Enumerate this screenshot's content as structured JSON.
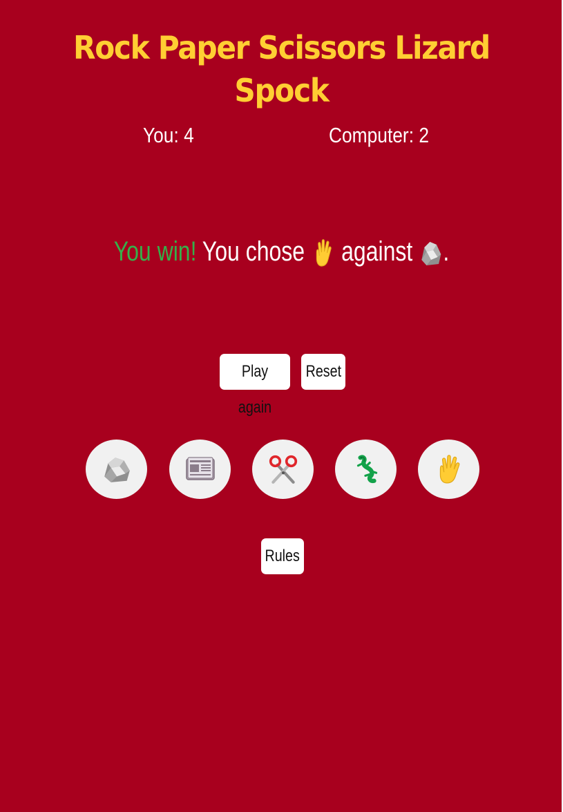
{
  "header": {
    "title": "Rock Paper Scissors Lizard Spock"
  },
  "score": {
    "you": "You: 4",
    "computer": "Computer: 2"
  },
  "result": {
    "status": "You win!",
    "you_chose": "You chose",
    "against": "against",
    "end": ".",
    "player_choice_icon": "spock-hand-icon",
    "computer_choice_icon": "rock-icon"
  },
  "buttons": {
    "play_again": "Play again",
    "reset": "Reset",
    "rules": "Rules"
  },
  "choices": [
    {
      "name": "rock",
      "icon": "rock-icon"
    },
    {
      "name": "paper",
      "icon": "newspaper-icon"
    },
    {
      "name": "scissors",
      "icon": "scissors-icon"
    },
    {
      "name": "lizard",
      "icon": "lizard-icon"
    },
    {
      "name": "spock",
      "icon": "spock-hand-icon"
    }
  ],
  "colors": {
    "background": "#a8001e",
    "title": "#ffcf33",
    "win": "#35b04a",
    "text": "#ffffff",
    "button_bg": "#ffffff",
    "choice_bg": "#f1f1f1"
  }
}
